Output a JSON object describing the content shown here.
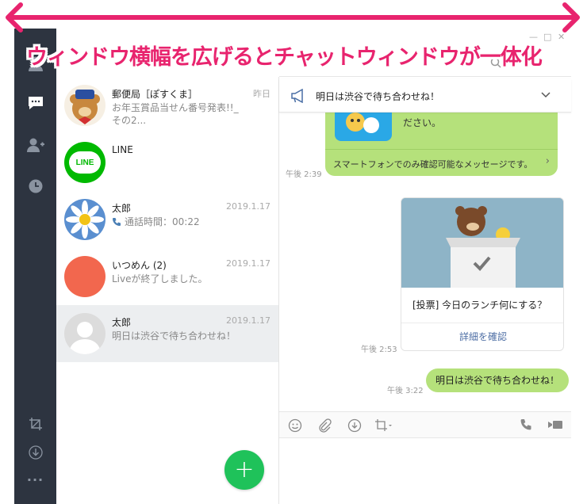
{
  "annotation": {
    "banner_text": "ウィンドウ横幅を広げるとチャットウィンドウが一体化"
  },
  "sidebar": {
    "icons": [
      "person-icon",
      "chat-icon",
      "add-friend-icon",
      "clock-icon",
      "crop-icon",
      "download-icon",
      "more-icon"
    ],
    "more_label": "..."
  },
  "chat_list": {
    "items": [
      {
        "name": "郵便局［ぽすくま］",
        "date": "昨日",
        "preview": "お年玉賞品当せん番号発表!!_その2..."
      },
      {
        "name": "LINE",
        "date": "",
        "preview": ""
      },
      {
        "name": "太郎",
        "date": "2019.1.17",
        "preview": "通話時間：00:22"
      },
      {
        "name": "いつめん (2)",
        "date": "2019.1.17",
        "preview": "Liveが終了しました。"
      },
      {
        "name": "太郎",
        "date": "2019.1.17",
        "preview": "明日は渋谷で待ち合わせね！"
      }
    ],
    "line_logo_text": "LINE",
    "fab_label": "+"
  },
  "chat": {
    "announcement": "明日は渋谷で待ち合わせね！",
    "msg1_text": "ださい。",
    "msg1_footer": "スマートフォンでのみ確認可能なメッセージです。",
    "msg1_time": "午後 2:39",
    "vote_title": "[投票] 今日のランチ何にする？",
    "vote_button": "詳細を確認",
    "vote_time": "午後 2:53",
    "msg2_text": "明日は渋谷で待ち合わせね！",
    "msg2_time": "午後 3:22"
  },
  "colors": {
    "accent": "#e8246e",
    "rail": "#2d3440",
    "bubble": "#b5e17b",
    "fab": "#1fc25a"
  }
}
